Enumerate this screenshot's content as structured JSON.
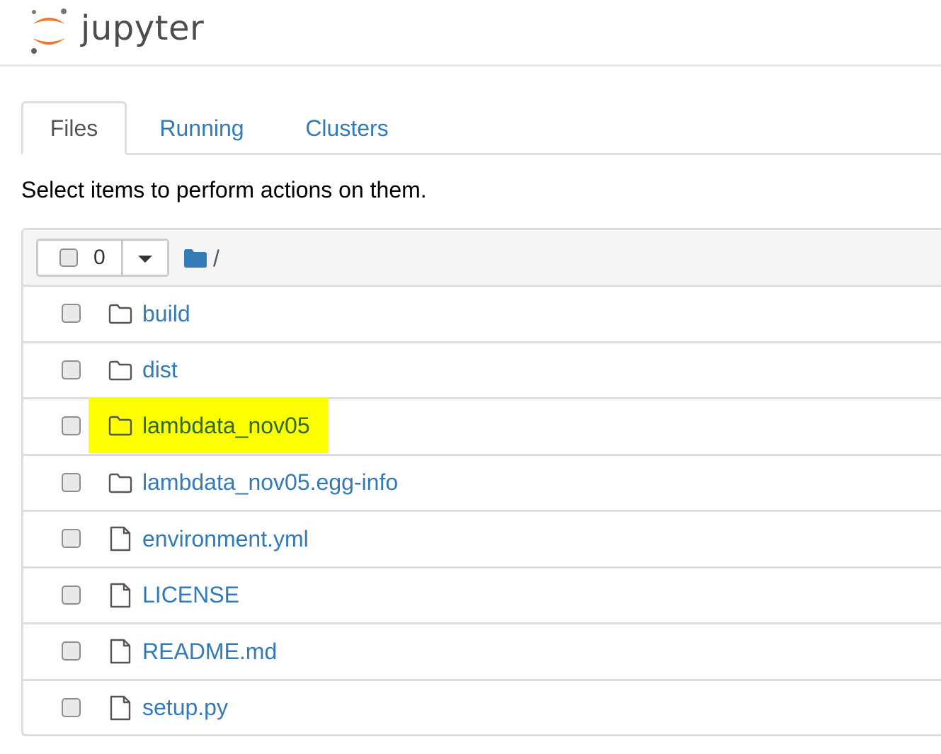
{
  "header": {
    "logo_text": "jupyter",
    "logo_colors": {
      "orange": "#f37726",
      "gray": "#616262",
      "text": "#4d4d4d"
    }
  },
  "tabs": [
    {
      "label": "Files",
      "active": true
    },
    {
      "label": "Running",
      "active": false
    },
    {
      "label": "Clusters",
      "active": false
    }
  ],
  "instructions": "Select items to perform actions on them.",
  "toolbar": {
    "selected_count": "0",
    "breadcrumb_root": "/"
  },
  "items": [
    {
      "name": "build",
      "type": "folder",
      "icon": "folder-icon",
      "highlighted": false
    },
    {
      "name": "dist",
      "type": "folder",
      "icon": "folder-icon",
      "highlighted": false
    },
    {
      "name": "lambdata_nov05",
      "type": "folder",
      "icon": "folder-icon",
      "highlighted": true
    },
    {
      "name": "lambdata_nov05.egg-info",
      "type": "folder",
      "icon": "folder-icon",
      "highlighted": false
    },
    {
      "name": "environment.yml",
      "type": "file",
      "icon": "file-icon",
      "highlighted": false
    },
    {
      "name": "LICENSE",
      "type": "file",
      "icon": "file-icon",
      "highlighted": false
    },
    {
      "name": "README.md",
      "type": "file",
      "icon": "file-icon",
      "highlighted": false
    },
    {
      "name": "setup.py",
      "type": "file",
      "icon": "file-icon",
      "highlighted": false
    }
  ],
  "colors": {
    "link": "#337ab7",
    "highlight": "#ffff00",
    "border": "#dddddd",
    "header_bg": "#f5f5f5"
  }
}
